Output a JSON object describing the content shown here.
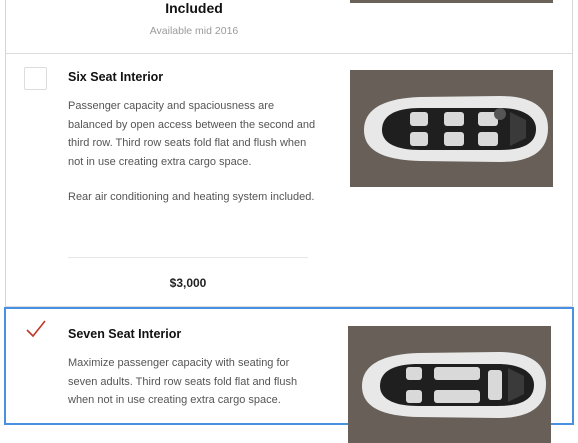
{
  "top_option": {
    "status": "Included",
    "availability": "Available mid 2016"
  },
  "options": [
    {
      "title": "Six Seat Interior",
      "description": "Passenger capacity and spaciousness are balanced by open access between the second and third row. Third row seats fold flat and flush when not in use creating extra cargo space.",
      "note": "Rear air conditioning and heating system included.",
      "price": "$3,000",
      "selected": false,
      "image_icon": "car-top-view-six-seat"
    },
    {
      "title": "Seven Seat Interior",
      "description": "Maximize passenger capacity with seating for seven adults. Third row seats fold flat and flush when not in use creating extra cargo space.",
      "selected": true,
      "image_icon": "car-top-view-seven-seat"
    }
  ],
  "colors": {
    "selection_border": "#4a90e2",
    "check_mark": "#c0392b",
    "car_floor": "#6e665c"
  }
}
